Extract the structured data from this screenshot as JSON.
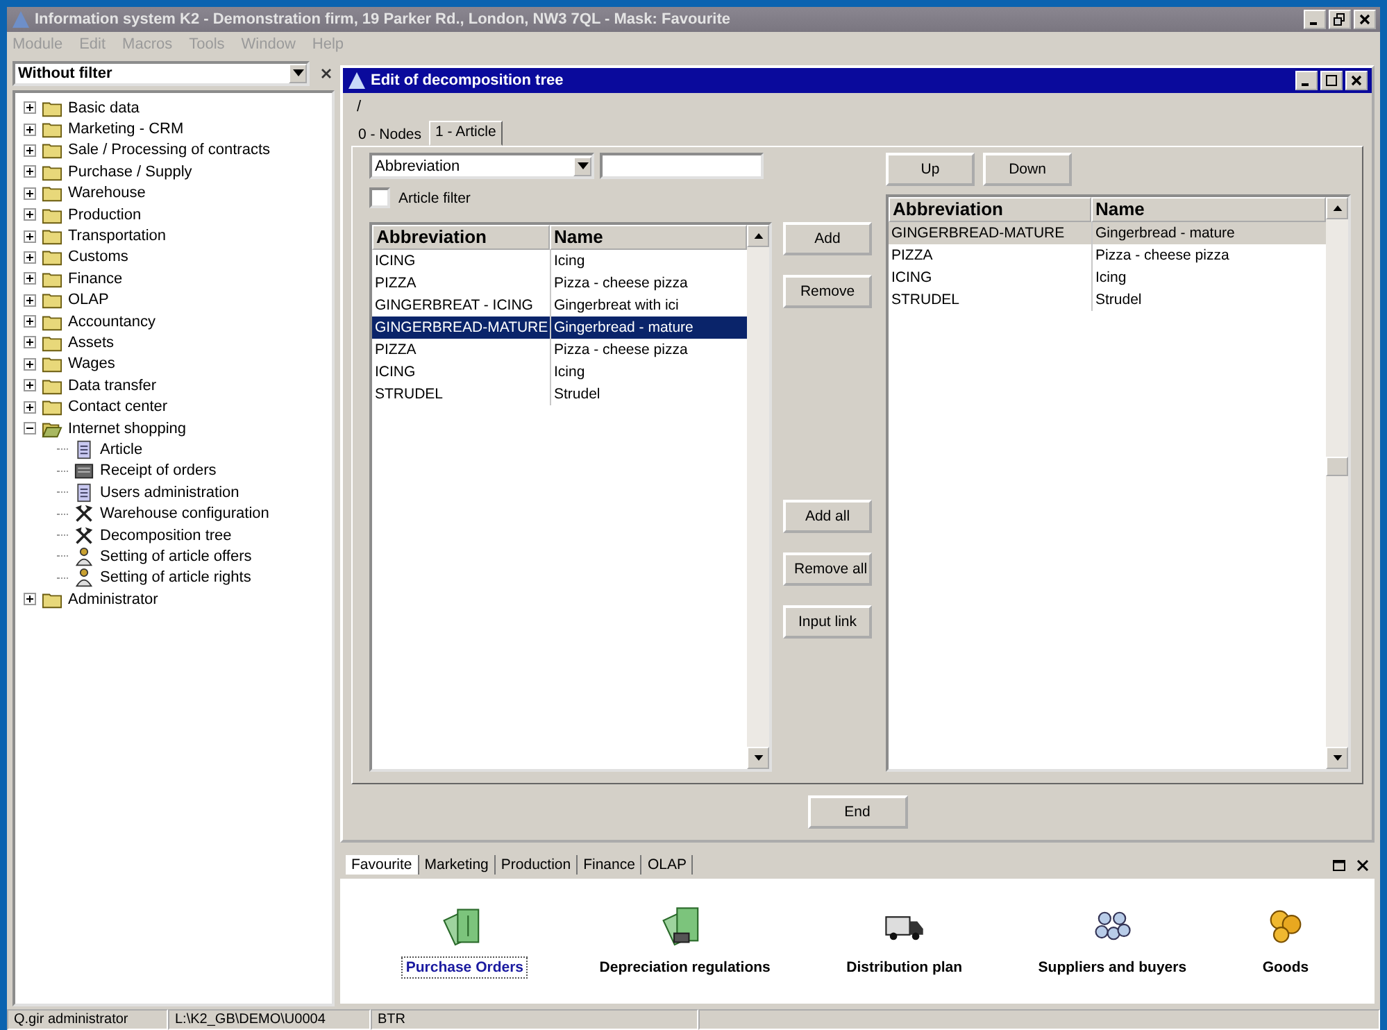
{
  "app_window": {
    "title": "Information system K2 - Demonstration firm, 19 Parker Rd., London, NW3 7QL - Mask: Favourite",
    "menu": [
      "Module",
      "Edit",
      "Macros",
      "Tools",
      "Window",
      "Help"
    ]
  },
  "sidebar": {
    "filter": "Without filter",
    "tree": [
      {
        "label": "Basic data",
        "kind": "folder",
        "expanded": false
      },
      {
        "label": "Marketing - CRM",
        "kind": "folder",
        "expanded": false
      },
      {
        "label": "Sale / Processing of contracts",
        "kind": "folder",
        "expanded": false
      },
      {
        "label": "Purchase / Supply",
        "kind": "folder",
        "expanded": false
      },
      {
        "label": "Warehouse",
        "kind": "folder",
        "expanded": false
      },
      {
        "label": "Production",
        "kind": "folder",
        "expanded": false
      },
      {
        "label": "Transportation",
        "kind": "folder",
        "expanded": false
      },
      {
        "label": "Customs",
        "kind": "folder",
        "expanded": false
      },
      {
        "label": "Finance",
        "kind": "folder",
        "expanded": false
      },
      {
        "label": "OLAP",
        "kind": "folder",
        "expanded": false
      },
      {
        "label": "Accountancy",
        "kind": "folder",
        "expanded": false
      },
      {
        "label": "Assets",
        "kind": "folder",
        "expanded": false
      },
      {
        "label": "Wages",
        "kind": "folder",
        "expanded": false
      },
      {
        "label": "Data transfer",
        "kind": "folder",
        "expanded": false
      },
      {
        "label": "Contact center",
        "kind": "folder",
        "expanded": false
      },
      {
        "label": "Internet shopping",
        "kind": "folder",
        "expanded": true,
        "children": [
          {
            "label": "Article",
            "kind": "document"
          },
          {
            "label": "Receipt of orders",
            "kind": "receipt"
          },
          {
            "label": "Users administration",
            "kind": "document"
          },
          {
            "label": "Warehouse configuration",
            "kind": "tools"
          },
          {
            "label": "Decomposition tree",
            "kind": "tools"
          },
          {
            "label": "Setting of article offers",
            "kind": "person"
          },
          {
            "label": "Setting of article rights",
            "kind": "person"
          }
        ]
      },
      {
        "label": "Administrator",
        "kind": "folder",
        "expanded": false
      }
    ]
  },
  "editor_window": {
    "title": "Edit of decomposition tree",
    "path": "/",
    "tabs": [
      {
        "label": "0 - Nodes",
        "selected": false
      },
      {
        "label": "1 - Article",
        "selected": true
      }
    ],
    "search_column": "Abbreviation",
    "article_filter": {
      "label": "Article filter",
      "checked": false
    },
    "available_table": {
      "columns": [
        "Abbreviation",
        "Name"
      ],
      "rows": [
        {
          "cells": [
            "ICING",
            "Icing"
          ],
          "selected": false
        },
        {
          "cells": [
            "PIZZA",
            "Pizza - cheese pizza"
          ],
          "selected": false
        },
        {
          "cells": [
            "GINGERBREAT - ICING",
            "Gingerbreat with ici"
          ],
          "selected": false
        },
        {
          "cells": [
            "GINGERBREAD-MATURE",
            "Gingerbread - mature"
          ],
          "selected": true
        },
        {
          "cells": [
            "PIZZA",
            "Pizza - cheese pizza"
          ],
          "selected": false
        },
        {
          "cells": [
            "ICING",
            "Icing"
          ],
          "selected": false
        },
        {
          "cells": [
            "STRUDEL",
            "Strudel"
          ],
          "selected": false
        }
      ]
    },
    "transfer_buttons": [
      "Add",
      "Remove"
    ],
    "bulk_buttons": [
      "Add all",
      "Remove all",
      "Input link"
    ],
    "order_buttons": [
      "Up",
      "Down"
    ],
    "chosen_table": {
      "columns": [
        "Abbreviation",
        "Name"
      ],
      "rows": [
        {
          "cells": [
            "GINGERBREAD-MATURE",
            "Gingerbread - mature"
          ],
          "selected": true
        },
        {
          "cells": [
            "PIZZA",
            "Pizza - cheese pizza"
          ],
          "selected": false
        },
        {
          "cells": [
            "ICING",
            "Icing"
          ],
          "selected": false
        },
        {
          "cells": [
            "STRUDEL",
            "Strudel"
          ],
          "selected": false
        }
      ]
    },
    "end_button": "End"
  },
  "favourites_panel": {
    "tabs": [
      {
        "label": "Favourite",
        "selected": true
      },
      {
        "label": "Marketing",
        "selected": false
      },
      {
        "label": "Production",
        "selected": false
      },
      {
        "label": "Finance",
        "selected": false
      },
      {
        "label": "OLAP",
        "selected": false
      }
    ],
    "shortcuts": [
      {
        "label": "Purchase Orders",
        "kind": "money",
        "selected": true
      },
      {
        "label": "Depreciation regulations",
        "kind": "money-truck",
        "selected": false
      },
      {
        "label": "Distribution plan",
        "kind": "truck",
        "selected": false
      },
      {
        "label": "Suppliers and buyers",
        "kind": "people",
        "selected": false
      },
      {
        "label": "Goods",
        "kind": "coins",
        "selected": false
      }
    ]
  },
  "status_bar": [
    "Q.gir administrator",
    "L:\\K2_GB\\DEMO\\U0004",
    "BTR"
  ]
}
